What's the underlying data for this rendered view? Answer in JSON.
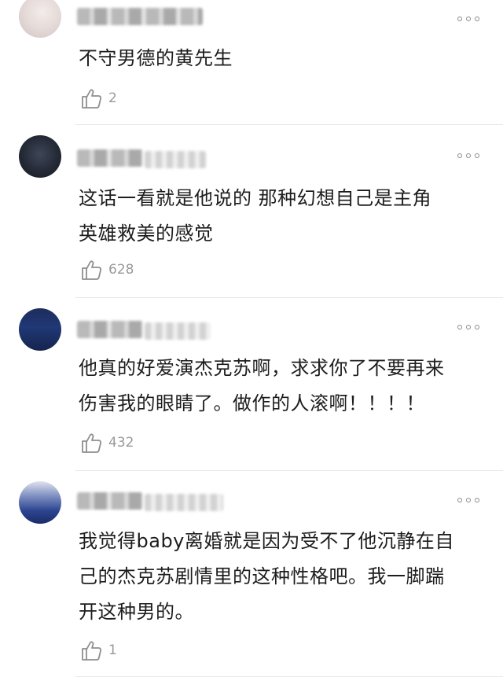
{
  "comments": [
    {
      "text_lines": [
        "不守男德的黄先生"
      ],
      "likes": "2"
    },
    {
      "text_lines": [
        "这话一看就是他说的 那种幻想自己是主角",
        "英雄救美的感觉"
      ],
      "likes": "628"
    },
    {
      "text_lines": [
        "他真的好爱演杰克苏啊，求求你了不要再来",
        "伤害我的眼睛了。做作的人滚啊！！！！"
      ],
      "likes": "432"
    },
    {
      "text_lines": [
        "我觉得baby离婚就是因为受不了他沉静在自",
        "己的杰克苏剧情里的这种性格吧。我一脚踹",
        "开这种男的。"
      ],
      "likes": "1"
    }
  ],
  "icons": {
    "like": "thumbs-up-outline-icon",
    "more": "more-dots-icon"
  },
  "colors": {
    "text": "#1d1d1d",
    "muted": "#9a9a9a",
    "divider": "#e6e6e6"
  }
}
